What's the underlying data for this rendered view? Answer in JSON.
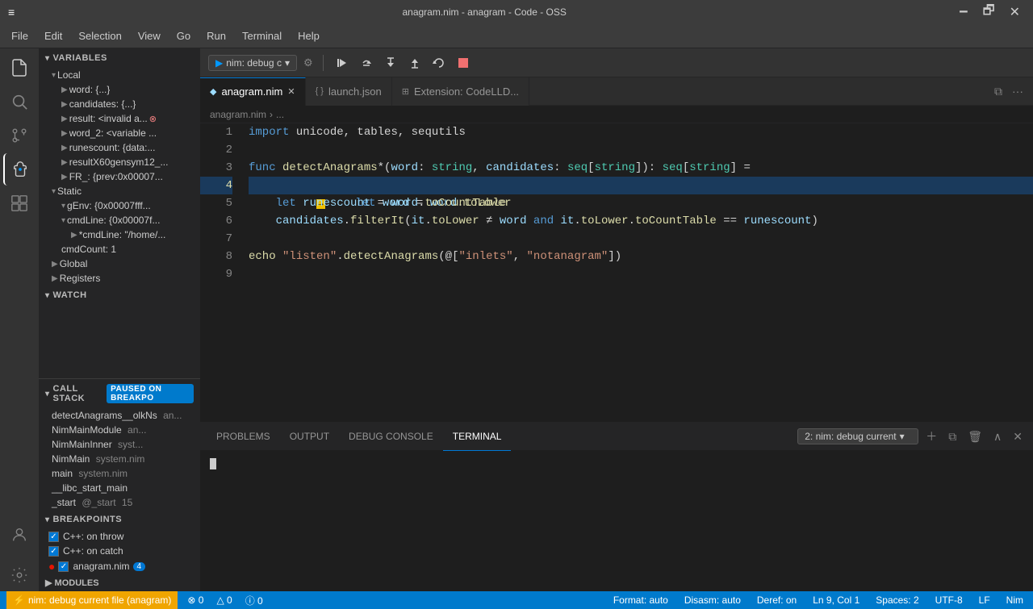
{
  "titlebar": {
    "title": "anagram.nim - anagram - Code - OSS",
    "controls": [
      "⊟",
      "⊡",
      "✕"
    ]
  },
  "menubar": {
    "items": [
      "File",
      "Edit",
      "Selection",
      "View",
      "Go",
      "Run",
      "Terminal",
      "Help"
    ]
  },
  "activitybar": {
    "icons": [
      {
        "name": "explorer",
        "symbol": "⎘",
        "active": true
      },
      {
        "name": "search",
        "symbol": "🔍"
      },
      {
        "name": "source-control",
        "symbol": "⑂"
      },
      {
        "name": "debug",
        "symbol": "▷",
        "active_debug": true
      },
      {
        "name": "extensions",
        "symbol": "⊞"
      }
    ]
  },
  "sidebar": {
    "variables_header": "VARIABLES",
    "local_label": "Local",
    "local_items": [
      {
        "label": "word: {...}",
        "indent": 1
      },
      {
        "label": "candidates: {...}",
        "indent": 1
      },
      {
        "label": "result: <invalid a...",
        "indent": 1,
        "has_icon": true
      },
      {
        "label": "word_2: <variable ...",
        "indent": 1
      },
      {
        "label": "runescount: {data:...",
        "indent": 1
      },
      {
        "label": "resultX60gensym12_...",
        "indent": 1
      },
      {
        "label": "FR_: {prev:0x00007...",
        "indent": 1
      }
    ],
    "static_label": "Static",
    "static_items": [
      {
        "label": "gEnv: {0x00007fff...",
        "indent": 1,
        "expandable": true
      },
      {
        "label": "cmdLine: {0x00007f...",
        "indent": 1,
        "expandable": true
      },
      {
        "label": "*cmdLine: \"/home/...",
        "indent": 2
      },
      {
        "label": "cmdCount: 1",
        "indent": 1
      }
    ],
    "global_label": "Global",
    "registers_label": "Registers",
    "watch_header": "WATCH",
    "callstack_header": "CALL STACK",
    "paused_text": "PAUSED ON BREAKPO",
    "call_stack_items": [
      {
        "name": "detectAnagrams__olkNs",
        "file": "an...",
        "line": ""
      },
      {
        "name": "NimMainModule",
        "file": "an...",
        "line": ""
      },
      {
        "name": "NimMainInner",
        "file": "syst...",
        "line": ""
      },
      {
        "name": "NimMain",
        "file": "system.nim",
        "line": ""
      },
      {
        "name": "main",
        "file": "system.nim",
        "line": ""
      },
      {
        "name": "__libc_start_main",
        "file": "",
        "line": ""
      },
      {
        "name": "_start",
        "file": "@_start",
        "line": "15"
      }
    ],
    "breakpoints_header": "BREAKPOINTS",
    "breakpoints": [
      {
        "label": "C++: on throw",
        "checked": true
      },
      {
        "label": "C++: on catch",
        "checked": true
      },
      {
        "label": "anagram.nim",
        "checked": true,
        "count": "4",
        "has_dot": true
      }
    ],
    "modules_header": "MODULES"
  },
  "debug_toolbar": {
    "config_label": "nim: debug c",
    "settings_icon": "⚙",
    "buttons": [
      {
        "name": "continue",
        "symbol": "▶",
        "title": "Continue"
      },
      {
        "name": "step-over",
        "symbol": "↷",
        "title": "Step Over"
      },
      {
        "name": "step-into",
        "symbol": "↓",
        "title": "Step Into"
      },
      {
        "name": "step-out",
        "symbol": "↑",
        "title": "Step Out"
      },
      {
        "name": "restart",
        "symbol": "↺",
        "title": "Restart"
      },
      {
        "name": "stop",
        "symbol": "⬛",
        "title": "Stop"
      }
    ]
  },
  "tabs": [
    {
      "label": "anagram.nim",
      "active": true,
      "modified": false,
      "icon": "●"
    },
    {
      "label": "launch.json",
      "active": false
    },
    {
      "label": "Extension: CodeLLD...",
      "active": false
    }
  ],
  "breadcrumb": {
    "parts": [
      "anagram.nim",
      "..."
    ]
  },
  "code": {
    "lines": [
      {
        "num": "1",
        "content": "import unicode, tables, sequtils",
        "tokens": [
          {
            "t": "kw",
            "v": "import"
          },
          {
            "t": "op",
            "v": " unicode, tables, sequtils"
          }
        ]
      },
      {
        "num": "2",
        "content": ""
      },
      {
        "num": "3",
        "content": "func detectAnagrams*(word: string, candidates: seq[string]): seq[string] =",
        "highlighted": false
      },
      {
        "num": "4",
        "content": "    let word = word.toLower",
        "highlighted": true
      },
      {
        "num": "5",
        "content": "    let runescount = word.toCountTable"
      },
      {
        "num": "6",
        "content": "    candidates.filterIt(it.toLower ≠ word and it.toLower.toCountTable == runescount)"
      },
      {
        "num": "7",
        "content": ""
      },
      {
        "num": "8",
        "content": "echo \"listen\".detectAnagrams(@[\"inlets\", \"notanagram\"])"
      },
      {
        "num": "9",
        "content": ""
      }
    ]
  },
  "bottom_panel": {
    "tabs": [
      "PROBLEMS",
      "OUTPUT",
      "DEBUG CONSOLE",
      "TERMINAL"
    ],
    "active_tab": "TERMINAL",
    "terminal_select": "2: nim: debug current",
    "terminal_content": ""
  },
  "statusbar": {
    "debug_label": "nim: debug current file (anagram)",
    "format": "Format: auto",
    "disasm": "Disasm: auto",
    "deref": "Deref: on",
    "ln_col": "Ln 9, Col 1",
    "spaces": "Spaces: 2",
    "encoding": "UTF-8",
    "line_ending": "LF",
    "language": "Nim",
    "errors": "⊗ 0",
    "warnings": "△ 0",
    "info": "ⓘ 0"
  }
}
